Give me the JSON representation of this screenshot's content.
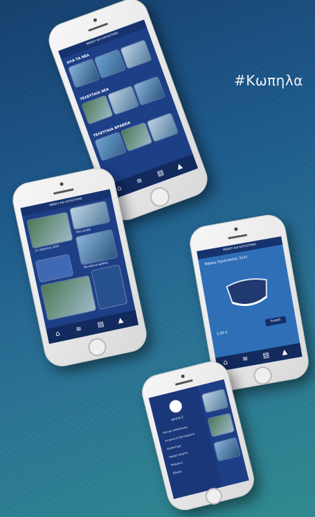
{
  "hashtag": "#Κωπηλα",
  "phone_news": {
    "title": "ΜΕΝΟΥ ΚΑΙ ΚΑΤΑΣΤΗΜΑ",
    "sections": [
      "ΟΛΑ ΤΑ ΝΕΑ",
      "ΤΕΛΕΥΤΑΙΑ ΝΕΑ",
      "ΤΕΛΕΥΤΑΙΑ ΒΡΑΒΕΙΑ"
    ]
  },
  "phone_gallery": {
    "title": "ΜΕΝΟΥ ΚΑΙ ΚΑΤΑΣΤΗΜΑ",
    "caption1": "27 Απριλίου 2024",
    "caption2": "Νέο ρεκόρ",
    "caption3": "Μετάλλια ομάδας"
  },
  "phone_shop": {
    "title": "ΜΕΝΟΥ ΚΑΙ ΚΑΤΑΣΤΗΜΑ",
    "product": "Μάσκα Προστασίας Συλλ",
    "price": "5,00 €",
    "buy": "Αγορά"
  },
  "phone_menu": {
    "user": "ΑΡΙΣΤΑ Ζ",
    "items": [
      "Κέντρο εκπαίδευσης",
      "Ιστορικό & Επιτεύγματα",
      "Κατάστημα",
      "Προφίλ Χρήστη",
      "Ρυθμίσεις",
      "Έξοδος"
    ]
  },
  "nav_icons": [
    "home-icon",
    "rowing-icon",
    "stats-icon",
    "user-icon"
  ]
}
